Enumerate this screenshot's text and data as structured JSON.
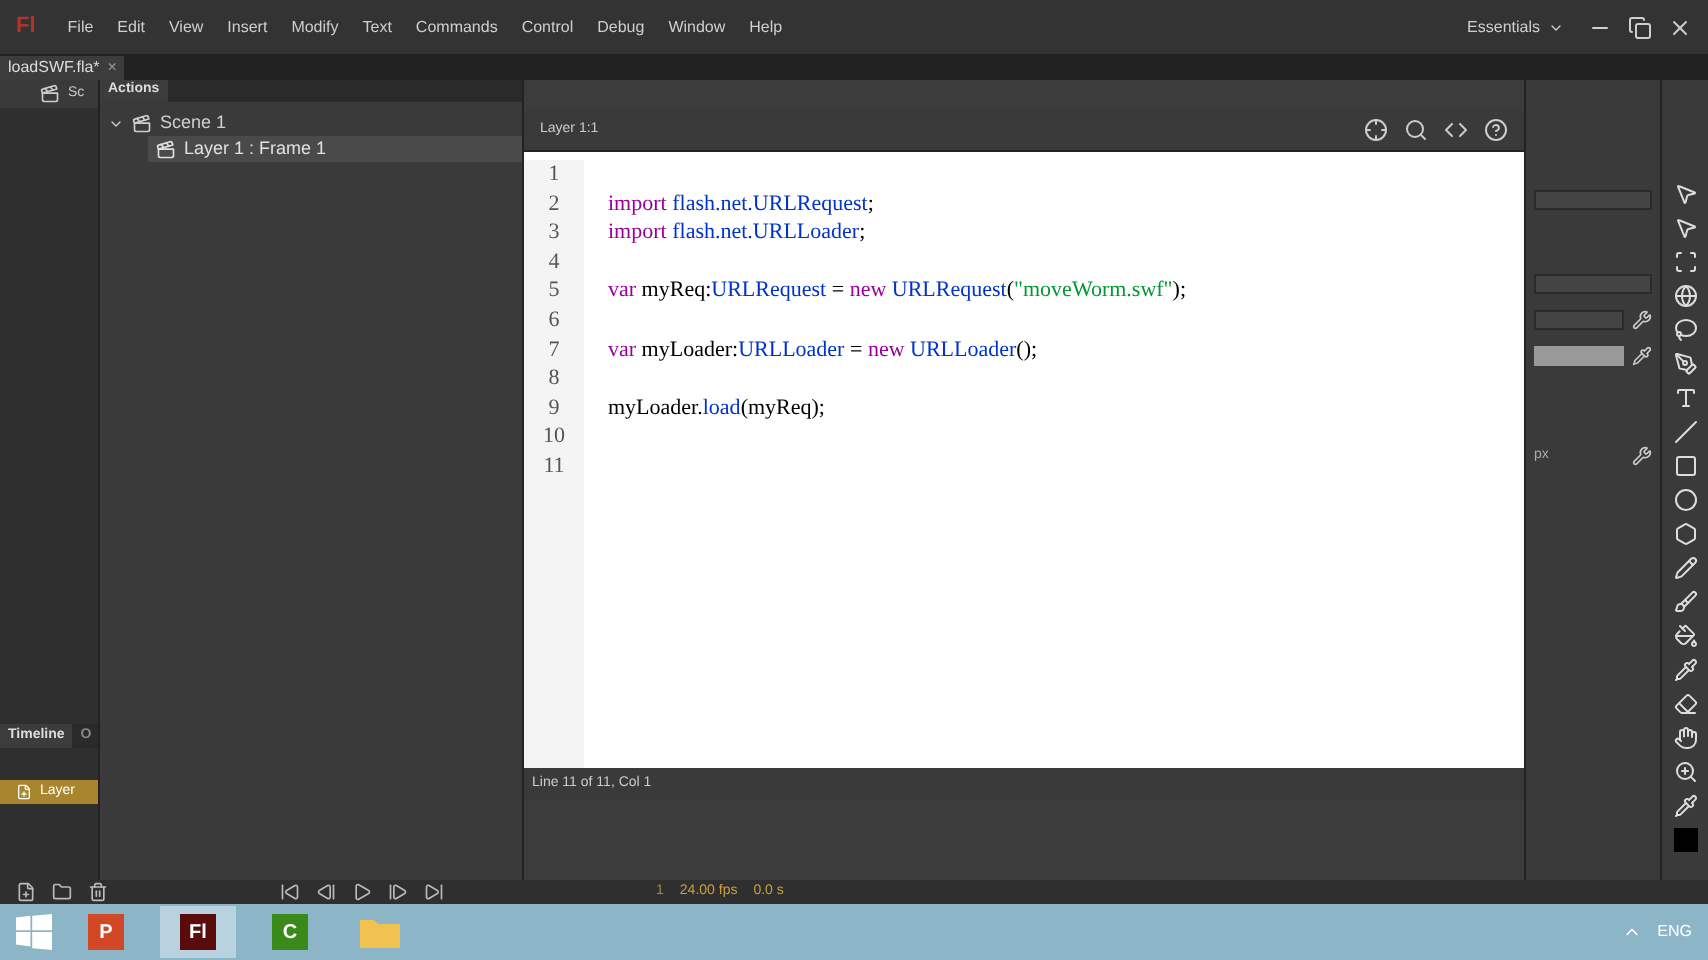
{
  "app": {
    "logo": "Fl",
    "menu": [
      "File",
      "Edit",
      "View",
      "Insert",
      "Modify",
      "Text",
      "Commands",
      "Control",
      "Debug",
      "Window",
      "Help"
    ],
    "workspace": "Essentials"
  },
  "document_tab": {
    "label": "loadSWF.fla*",
    "close": "×",
    "selected": true
  },
  "stage_bar": {
    "label": "Sc"
  },
  "actions_panel": {
    "title": "Actions",
    "tree": [
      {
        "label": "Scene 1",
        "expanded": true,
        "selected": false,
        "children": [
          {
            "label": "Layer 1 : Frame 1",
            "selected": true
          }
        ]
      }
    ]
  },
  "editor": {
    "title": "Layer 1:1",
    "lines": [
      {
        "number": "1"
      },
      {
        "number": "2",
        "tokens": [
          {
            "kind": "keyword",
            "text": "import "
          },
          {
            "kind": "type",
            "text": "flash.net.URLRequest"
          },
          {
            "kind": "plain",
            "text": ";"
          }
        ]
      },
      {
        "number": "3",
        "tokens": [
          {
            "kind": "keyword",
            "text": "import "
          },
          {
            "kind": "type",
            "text": "flash.net.URLLoader"
          },
          {
            "kind": "plain",
            "text": ";"
          }
        ]
      },
      {
        "number": "4"
      },
      {
        "number": "5",
        "tokens": [
          {
            "kind": "keyword",
            "text": "var"
          },
          {
            "kind": "plain",
            "text": " myReq:"
          },
          {
            "kind": "type",
            "text": "URLRequest"
          },
          {
            "kind": "plain",
            "text": " = "
          },
          {
            "kind": "keyword",
            "text": "new "
          },
          {
            "kind": "type",
            "text": "URLRequest"
          },
          {
            "kind": "plain",
            "text": "("
          },
          {
            "kind": "string",
            "text": "\"moveWorm.swf\""
          },
          {
            "kind": "plain",
            "text": ");"
          }
        ]
      },
      {
        "number": "6"
      },
      {
        "number": "7",
        "tokens": [
          {
            "kind": "keyword",
            "text": "var"
          },
          {
            "kind": "plain",
            "text": " myLoader:"
          },
          {
            "kind": "type",
            "text": "URLLoader"
          },
          {
            "kind": "plain",
            "text": " = "
          },
          {
            "kind": "keyword",
            "text": "new "
          },
          {
            "kind": "type",
            "text": "URLLoader"
          },
          {
            "kind": "plain",
            "text": "();"
          }
        ]
      },
      {
        "number": "8"
      },
      {
        "number": "9",
        "tokens": [
          {
            "kind": "plain",
            "text": "myLoader."
          },
          {
            "kind": "method",
            "text": "load"
          },
          {
            "kind": "plain",
            "text": "(myReq);"
          }
        ]
      },
      {
        "number": "10"
      },
      {
        "number": "11"
      }
    ],
    "status": "Line 11 of 11, Col 1"
  },
  "properties": {
    "unit": "px"
  },
  "timeline": {
    "tabs": [
      {
        "label": "Timeline",
        "selected": true
      },
      {
        "label": "O",
        "selected": false
      }
    ],
    "layer": {
      "label": "Layer",
      "selected": true
    },
    "frame": "1",
    "fps": "24.00 fps",
    "time": "0.0 s"
  },
  "taskbar": {
    "apps": [
      {
        "glyph": "P",
        "color": "#d24726",
        "selected": false
      },
      {
        "glyph": "Fl",
        "color": "#5a0b0b",
        "selected": true
      },
      {
        "glyph": "C",
        "color": "#3a8a1a",
        "selected": false
      }
    ],
    "language": "ENG"
  }
}
